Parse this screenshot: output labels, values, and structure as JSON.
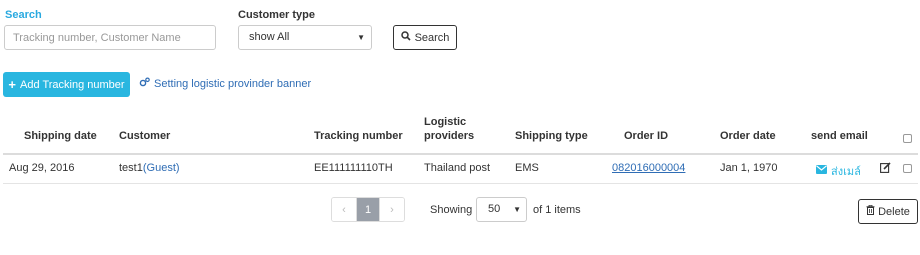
{
  "filters": {
    "search_label": "Search",
    "search_placeholder": "Tracking number, Customer Name",
    "customer_type_label": "Customer type",
    "customer_type_value": "show All",
    "search_button": "Search"
  },
  "actions": {
    "add_tracking": "Add Tracking number",
    "setting_banner": "Setting logistic provinder banner"
  },
  "table": {
    "headers": {
      "shipping_date": "Shipping date",
      "customer": "Customer",
      "tracking_number": "Tracking number",
      "logistic_providers_1": "Logistic",
      "logistic_providers_2": "providers",
      "shipping_type": "Shipping type",
      "order_id": "Order ID",
      "order_date": "Order date",
      "send_email": "send email"
    },
    "rows": [
      {
        "shipping_date": "Aug 29, 2016",
        "customer_name": "test1",
        "customer_tag": "(Guest)",
        "tracking_number": "EE111111110TH",
        "logistic_provider": "Thailand post",
        "shipping_type": "EMS",
        "order_id": "082016000004",
        "order_date": "Jan 1, 1970",
        "send_email_label": "ส่งเมล์"
      }
    ]
  },
  "pagination": {
    "prev": "‹",
    "current_page": "1",
    "next": "›",
    "showing_label": "Showing",
    "page_size": "50",
    "of_items": "of 1 items"
  },
  "delete_button": "Delete",
  "colors": {
    "accent": "#29b6e0",
    "link": "#2f6db5",
    "search_label": "#29a9e0"
  }
}
